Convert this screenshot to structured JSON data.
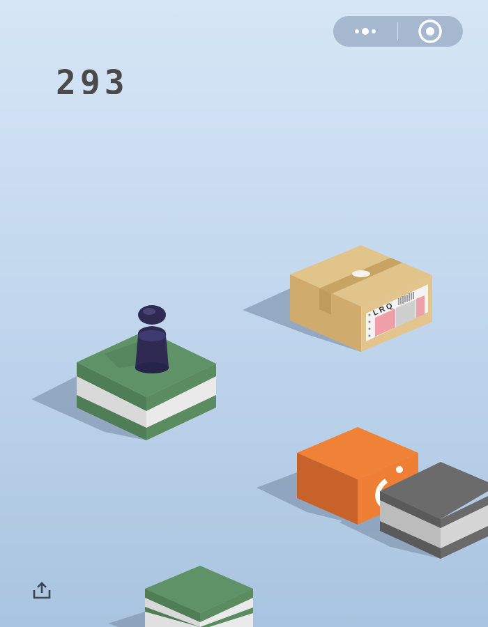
{
  "hud": {
    "score": "293",
    "menu_button_icon": "more-dots-icon",
    "close_button_icon": "target-circle-icon",
    "share_button_icon": "share-upload-icon"
  },
  "scene": {
    "platforms": [
      {
        "name": "green-striped-block-current",
        "color": "#5f9367"
      },
      {
        "name": "cardboard-box-target",
        "color": "#e1c48a",
        "label_text": "L R Q"
      },
      {
        "name": "orange-cube",
        "color": "#f07f36"
      },
      {
        "name": "gray-striped-block",
        "color": "#666666"
      },
      {
        "name": "green-striped-block-bottom",
        "color": "#5f9367"
      }
    ],
    "player_color": "#2e2a52"
  }
}
